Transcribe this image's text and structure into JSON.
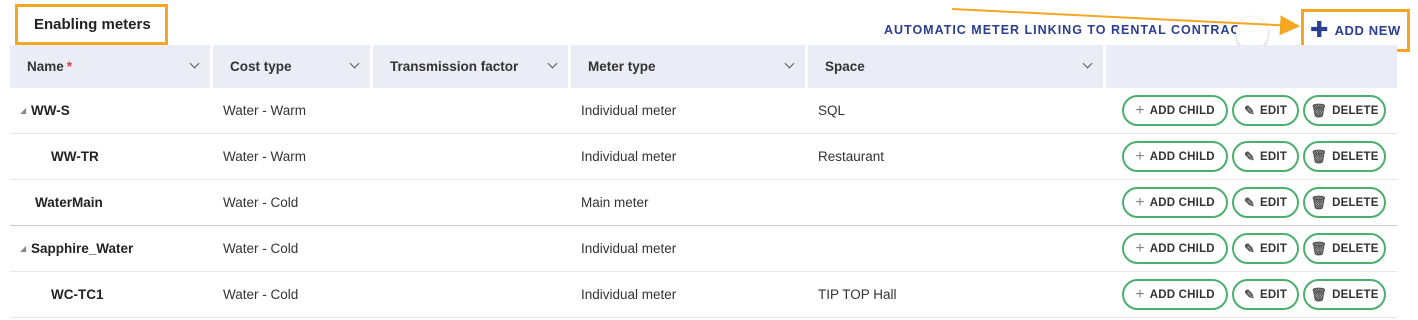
{
  "title": "Enabling meters",
  "auto_link_label": "AUTOMATIC METER LINKING TO RENTAL CONTRACTS",
  "add_new_label": "ADD NEW",
  "columns": {
    "name": "Name",
    "name_required": "*",
    "cost_type": "Cost type",
    "transmission_factor": "Transmission factor",
    "meter_type": "Meter type",
    "space": "Space"
  },
  "actions": {
    "add_child": "ADD CHILD",
    "edit": "EDIT",
    "delete": "DELETE"
  },
  "rows": [
    {
      "name": "WW-S",
      "cost_type": "Water - Warm",
      "transmission_factor": "",
      "meter_type": "Individual meter",
      "space": "SQL"
    },
    {
      "name": "WW-TR",
      "cost_type": "Water - Warm",
      "transmission_factor": "",
      "meter_type": "Individual meter",
      "space": "Restaurant"
    },
    {
      "name": "WaterMain",
      "cost_type": "Water - Cold",
      "transmission_factor": "",
      "meter_type": "Main meter",
      "space": ""
    },
    {
      "name": "Sapphire_Water",
      "cost_type": "Water - Cold",
      "transmission_factor": "",
      "meter_type": "Individual meter",
      "space": ""
    },
    {
      "name": "WC-TC1",
      "cost_type": "Water - Cold",
      "transmission_factor": "",
      "meter_type": "Individual meter",
      "space": "TIP TOP Hall"
    }
  ],
  "colors": {
    "highlight": "#f5a623",
    "accent": "#2b3f8f",
    "button_border": "#4caf6e",
    "header_bg": "#ebedf6",
    "required": "#e53935"
  }
}
